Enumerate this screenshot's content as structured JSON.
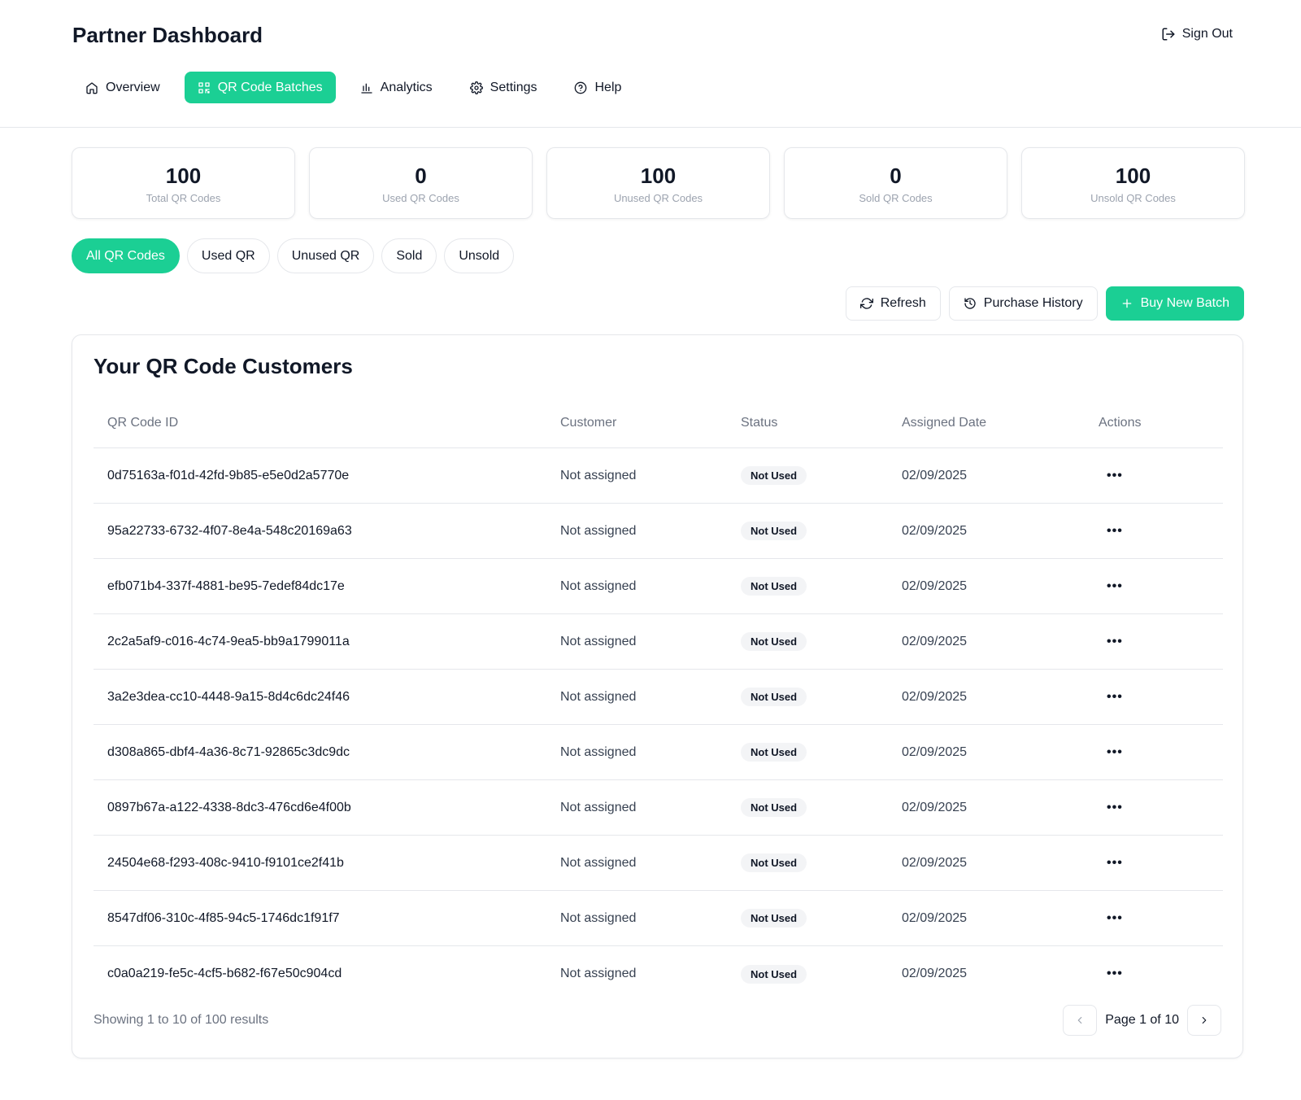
{
  "header": {
    "title": "Partner Dashboard",
    "sign_out": "Sign Out"
  },
  "nav": [
    {
      "label": "Overview",
      "icon": "home-icon",
      "active": false
    },
    {
      "label": "QR Code Batches",
      "icon": "qr-icon",
      "active": true
    },
    {
      "label": "Analytics",
      "icon": "bar-chart-icon",
      "active": false
    },
    {
      "label": "Settings",
      "icon": "gear-icon",
      "active": false
    },
    {
      "label": "Help",
      "icon": "help-circle-icon",
      "active": false
    }
  ],
  "stats": [
    {
      "value": "100",
      "label": "Total QR Codes"
    },
    {
      "value": "0",
      "label": "Used QR Codes"
    },
    {
      "value": "100",
      "label": "Unused QR Codes"
    },
    {
      "value": "0",
      "label": "Sold QR Codes"
    },
    {
      "value": "100",
      "label": "Unsold QR Codes"
    }
  ],
  "filters": [
    "All QR Codes",
    "Used QR",
    "Unused QR",
    "Sold",
    "Unsold"
  ],
  "active_filter": "All QR Codes",
  "actions": {
    "refresh": "Refresh",
    "purchase_history": "Purchase History",
    "buy_new_batch": "Buy New Batch"
  },
  "table": {
    "title": "Your QR Code Customers",
    "columns": [
      "QR Code ID",
      "Customer",
      "Status",
      "Assigned Date",
      "Actions"
    ],
    "rows": [
      {
        "id": "0d75163a-f01d-42fd-9b85-e5e0d2a5770e",
        "customer": "Not assigned",
        "status": "Not Used",
        "date": "02/09/2025"
      },
      {
        "id": "95a22733-6732-4f07-8e4a-548c20169a63",
        "customer": "Not assigned",
        "status": "Not Used",
        "date": "02/09/2025"
      },
      {
        "id": "efb071b4-337f-4881-be95-7edef84dc17e",
        "customer": "Not assigned",
        "status": "Not Used",
        "date": "02/09/2025"
      },
      {
        "id": "2c2a5af9-c016-4c74-9ea5-bb9a1799011a",
        "customer": "Not assigned",
        "status": "Not Used",
        "date": "02/09/2025"
      },
      {
        "id": "3a2e3dea-cc10-4448-9a15-8d4c6dc24f46",
        "customer": "Not assigned",
        "status": "Not Used",
        "date": "02/09/2025"
      },
      {
        "id": "d308a865-dbf4-4a36-8c71-92865c3dc9dc",
        "customer": "Not assigned",
        "status": "Not Used",
        "date": "02/09/2025"
      },
      {
        "id": "0897b67a-a122-4338-8dc3-476cd6e4f00b",
        "customer": "Not assigned",
        "status": "Not Used",
        "date": "02/09/2025"
      },
      {
        "id": "24504e68-f293-408c-9410-f9101ce2f41b",
        "customer": "Not assigned",
        "status": "Not Used",
        "date": "02/09/2025"
      },
      {
        "id": "8547df06-310c-4f85-94c5-1746dc1f91f7",
        "customer": "Not assigned",
        "status": "Not Used",
        "date": "02/09/2025"
      },
      {
        "id": "c0a0a219-fe5c-4cf5-b682-f67e50c904cd",
        "customer": "Not assigned",
        "status": "Not Used",
        "date": "02/09/2025"
      }
    ],
    "more_icon": "more-horizontal-icon"
  },
  "pagination": {
    "showing": "Showing 1 to 10 of 100 results",
    "page_label": "Page 1 of 10"
  },
  "colors": {
    "accent": "#1bcf94",
    "border": "#e5e7eb",
    "muted_text": "#6b7280",
    "badge_bg": "#f3f4f6"
  }
}
